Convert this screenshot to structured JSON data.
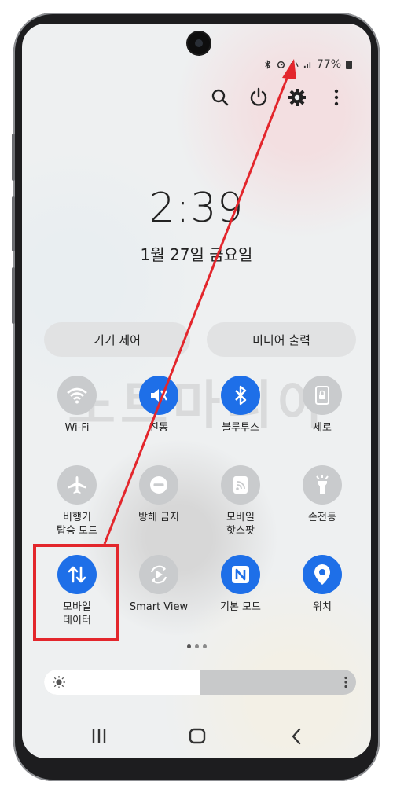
{
  "status_bar": {
    "battery_text": "77%",
    "icons": [
      "bluetooth-icon",
      "alarm-icon",
      "mute-icon",
      "signal-icon",
      "battery-icon"
    ]
  },
  "header_icons": [
    "search-icon",
    "power-icon",
    "settings-icon",
    "more-icon"
  ],
  "clock": {
    "time": "2:39",
    "date": "1월 27일 금요일"
  },
  "pills": {
    "device_control": "기기 제어",
    "media_output": "미디어 출력"
  },
  "watermark": "노트마니아",
  "tiles": [
    {
      "label": "Wi-Fi",
      "icon": "wifi-icon",
      "state": "off"
    },
    {
      "label": "진동",
      "icon": "vibrate-icon",
      "state": "on"
    },
    {
      "label": "블루투스",
      "icon": "bluetooth-icon",
      "state": "on"
    },
    {
      "label": "세로",
      "icon": "rotation-lock-icon",
      "state": "off"
    },
    {
      "label": "비행기\n탑승 모드",
      "icon": "airplane-icon",
      "state": "off"
    },
    {
      "label": "방해 금지",
      "icon": "do-not-disturb-icon",
      "state": "off"
    },
    {
      "label": "모바일\n핫스팟",
      "icon": "hotspot-icon",
      "state": "off"
    },
    {
      "label": "손전등",
      "icon": "flashlight-icon",
      "state": "off"
    },
    {
      "label": "모바일\n데이터",
      "icon": "mobile-data-icon",
      "state": "on"
    },
    {
      "label": "Smart View",
      "icon": "smart-view-icon",
      "state": "off"
    },
    {
      "label": "기본 모드",
      "icon": "nfc-icon",
      "state": "on"
    },
    {
      "label": "위치",
      "icon": "location-icon",
      "state": "on"
    }
  ],
  "brightness": {
    "level": 0.5,
    "icon": "brightness-icon"
  },
  "nav": [
    "recents-icon",
    "home-icon",
    "back-icon"
  ],
  "colors": {
    "accent": "#1e6fe8",
    "highlight": "#e3262c"
  }
}
